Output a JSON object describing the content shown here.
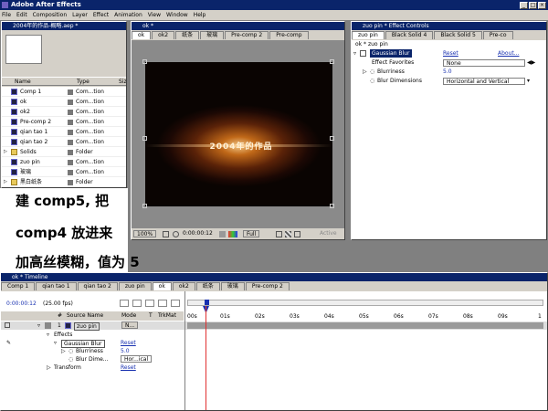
{
  "app": {
    "title": "Adobe After Effects"
  },
  "menu": [
    "File",
    "Edit",
    "Composition",
    "Layer",
    "Effect",
    "Animation",
    "View",
    "Window",
    "Help"
  ],
  "project": {
    "title": "2004年的作品-概略.aep *",
    "columns": {
      "name": "Name",
      "type": "Type",
      "size": "Siz"
    },
    "items": [
      {
        "name": "Comp 1",
        "type": "Com...tion",
        "kind": "comp"
      },
      {
        "name": "ok",
        "type": "Com...tion",
        "kind": "comp"
      },
      {
        "name": "ok2",
        "type": "Com...tion",
        "kind": "comp"
      },
      {
        "name": "Pre-comp 2",
        "type": "Com...tion",
        "kind": "comp"
      },
      {
        "name": "qian tao 1",
        "type": "Com...tion",
        "kind": "comp"
      },
      {
        "name": "qian tao 2",
        "type": "Com...tion",
        "kind": "comp"
      },
      {
        "name": "Solids",
        "type": "Folder",
        "kind": "folder"
      },
      {
        "name": "zuo pin",
        "type": "Com...tion",
        "kind": "comp"
      },
      {
        "name": "玻璃",
        "type": "Com...tion",
        "kind": "comp"
      },
      {
        "name": "黑白纸条",
        "type": "Folder",
        "kind": "folder"
      }
    ]
  },
  "caption": {
    "line1": "建 comp5, 把",
    "line2": "comp4 放进来",
    "line3": "加高丝模糊，值为 5"
  },
  "viewer": {
    "title": "ok * ",
    "tabs": [
      "ok",
      "ok2",
      "纸条",
      "玻璃",
      "Pre-comp 2",
      "Pre-comp"
    ],
    "overlay_text": "2004年的作品",
    "zoom": "100%",
    "timecode": "0:00:00:12",
    "resolution": "Full",
    "active": "Active"
  },
  "effect_controls": {
    "title": "zuo pin * Effect Controls",
    "tabs": [
      "zuo pin",
      "Black Solid 4",
      "Black Solid 5",
      "Pre-co"
    ],
    "breadcrumb": "ok * zuo pin",
    "effect_name": "Gaussian Blur",
    "reset": "Reset",
    "about": "About...",
    "favorites_label": "Effect Favorites",
    "favorites_value": "None",
    "blurriness_label": "Blurriness",
    "blurriness_value": "5.0",
    "dimensions_label": "Blur Dimensions",
    "dimensions_value": "Horizontal and Vertical"
  },
  "timeline": {
    "title": "ok * Timeline",
    "tabs": [
      "Comp 1",
      "qian tao 1",
      "qian tao 2",
      "zuo pin",
      "ok",
      "ok2",
      "纸条",
      "玻璃",
      "Pre-comp 2"
    ],
    "timecode": "0:00:00:12",
    "fps": "(25.00 fps)",
    "columns": {
      "num": "#",
      "source": "Source Name",
      "mode": "Mode",
      "t": "T",
      "trkmat": "TrkMat"
    },
    "ruler": [
      "00s",
      "01s",
      "02s",
      "03s",
      "04s",
      "05s",
      "06s",
      "07s",
      "08s",
      "09s",
      "1"
    ],
    "layer": {
      "num": "1",
      "name": "zuo pin",
      "mode": "N..."
    },
    "effects_label": "Effects",
    "effect_name": "Gaussian Blur",
    "reset": "Reset",
    "blurriness_label": "Blurriness",
    "blurriness_value": "5.0",
    "dimensions_label": "Blur Dime...",
    "dimensions_value": "Hor...ical",
    "transform_label": "Transform",
    "transform_reset": "Reset"
  }
}
